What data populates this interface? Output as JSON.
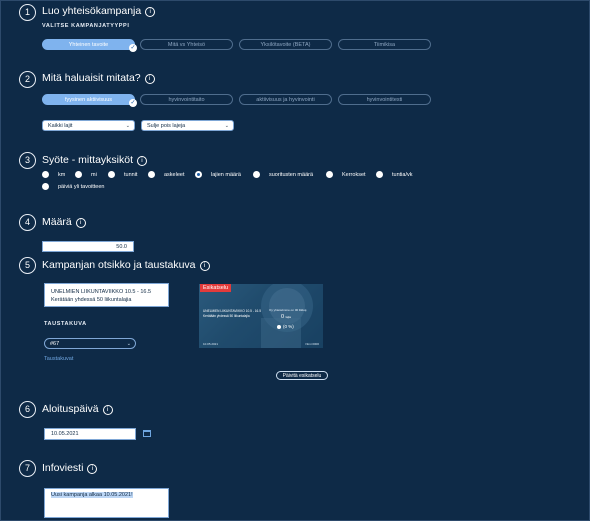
{
  "section1": {
    "number": "1",
    "title": "Luo yhteisökampanja",
    "subtitle": "VALITSE KAMPANJATYYPPI",
    "types": [
      "Yhteinen tavoite",
      "Mitä vs Yhteisö",
      "Yksilötavoite (BETA)",
      "Tiimikisa"
    ]
  },
  "section2": {
    "number": "2",
    "title": "Mitä haluaisit mitata?",
    "options": [
      "fyysinen aktiivisuus",
      "hyvinvointitaito",
      "aktiivisuus ja hyvinvointi",
      "hyvinvointitesti"
    ],
    "select1": "Kaikki lajit",
    "select2": "Sulje pois lajeja"
  },
  "section3": {
    "number": "3",
    "title": "Syöte - mittayksiköt",
    "units": [
      "km",
      "mi",
      "tunnit",
      "askeleet",
      "lajien määrä",
      "suoritusten määrä",
      "Kerrokset",
      "tuntia/vk",
      "päiviä yli tavoitteen"
    ]
  },
  "section4": {
    "number": "4",
    "title": "Määrä",
    "value": "50.0"
  },
  "section5": {
    "number": "5",
    "title": "Kampanjan otsikko ja taustakuva",
    "campaign_title_line1": "UNELMIEN LIIKUNTAVIIKKO 10.5 - 16.5",
    "campaign_title_line2": "Kerätään yhdessä 50 liikuntalajia",
    "background_label": "TAUSTAKUVA",
    "background_value": "#67",
    "background_link": "Taustakuvat",
    "preview_badge": "Esikatselu",
    "preview_title": "UNELMIEN LIIKUNTAVIIKKO 10.5 - 16.5",
    "preview_subtitle": "Kerätään yhdessä 50 liikuntalajia",
    "preview_stat_label": "Oy yhteisömme on 00 liikkuj.",
    "preview_stat_value": "0",
    "preview_stat_unit": "lajia",
    "preview_percent": "(0 %)",
    "preview_date": "10.05.2021",
    "preview_corner": "Nimi 0000",
    "update_button": "Päivitä esikatselu"
  },
  "section6": {
    "number": "6",
    "title": "Aloituspäivä",
    "date": "10.05.2021"
  },
  "section7": {
    "number": "7",
    "title": "Infoviesti",
    "message": "Uusi kampanja alkaa 10.05.2021!"
  },
  "colors": {
    "background": "#0e2a47",
    "accent": "#7fb3ee",
    "link": "#6fa6e0",
    "badge": "#e23b3b"
  }
}
